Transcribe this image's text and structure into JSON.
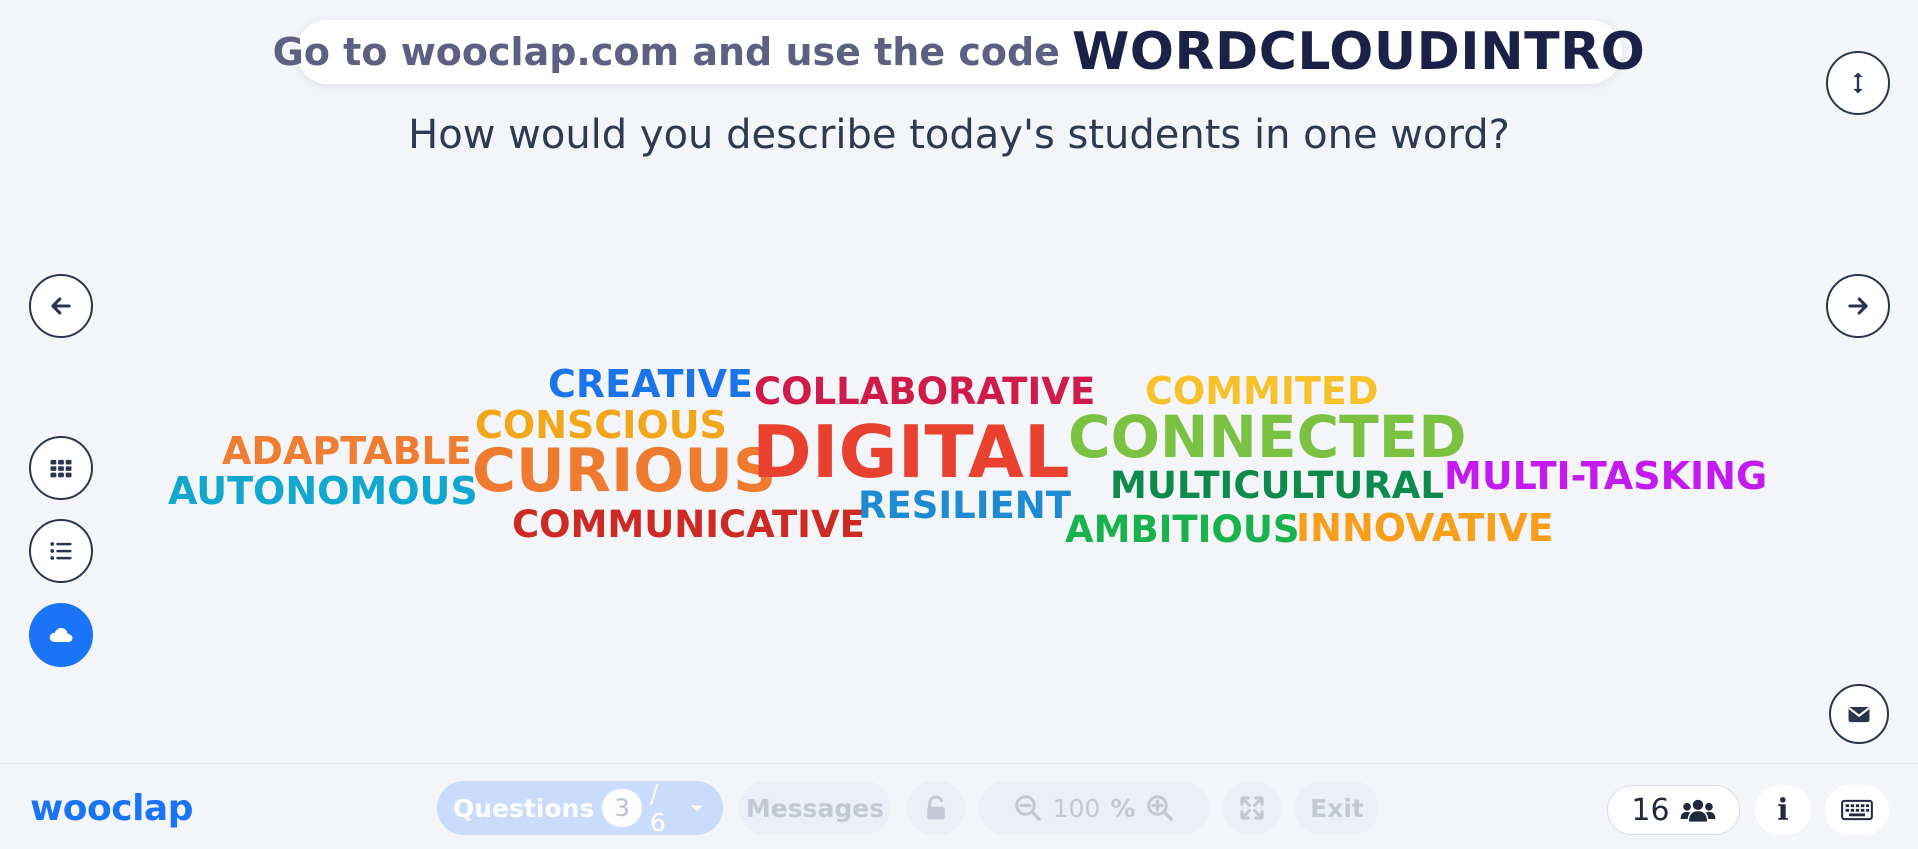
{
  "banner": {
    "go_to": "Go to",
    "url": "wooclap.com",
    "use_code": "and use the code",
    "code": "WORDCLOUDINTRO"
  },
  "question": "How would you describe today's students in one word?",
  "word_cloud": {
    "words": [
      {
        "text": "CREATIVE",
        "color": "#1b74e8"
      },
      {
        "text": "COLLABORATIVE",
        "color": "#cf1b4a"
      },
      {
        "text": "COMMITED",
        "color": "#f6c12a"
      },
      {
        "text": "CONSCIOUS",
        "color": "#f2a71a"
      },
      {
        "text": "ADAPTABLE",
        "color": "#ef7d32"
      },
      {
        "text": "CURIOUS",
        "color": "#ee7b30"
      },
      {
        "text": "DIGITAL",
        "color": "#e8412f"
      },
      {
        "text": "CONNECTED",
        "color": "#7cc242"
      },
      {
        "text": "MULTICULTURAL",
        "color": "#0e8a4c"
      },
      {
        "text": "MULTI-TASKING",
        "color": "#c21af0"
      },
      {
        "text": "AUTONOMOUS",
        "color": "#12a7cf"
      },
      {
        "text": "RESILIENT",
        "color": "#1e8ad1"
      },
      {
        "text": "COMMUNICATIVE",
        "color": "#cc2a22"
      },
      {
        "text": "AMBITIOUS",
        "color": "#19b24d"
      },
      {
        "text": "INNOVATIVE",
        "color": "#f79e1b"
      }
    ]
  },
  "side_buttons": {
    "left": [
      "arrow-left-icon",
      "grid-icon",
      "list-icon",
      "cloud-icon"
    ],
    "right": [
      "expand-vertical-icon",
      "arrow-right-icon",
      "mail-icon"
    ]
  },
  "bottom_bar": {
    "logo": "wooclap",
    "questions_label": "Questions",
    "question_current": "3",
    "question_total": "/ 6",
    "messages_label": "Messages",
    "zoom_value": "100",
    "zoom_unit": "%",
    "exit_label": "Exit",
    "participants_count": "16",
    "info_label": "i"
  },
  "colors": {
    "accent": "#1b74f5",
    "background": "#f3f5f9",
    "dark": "#1b2247"
  }
}
